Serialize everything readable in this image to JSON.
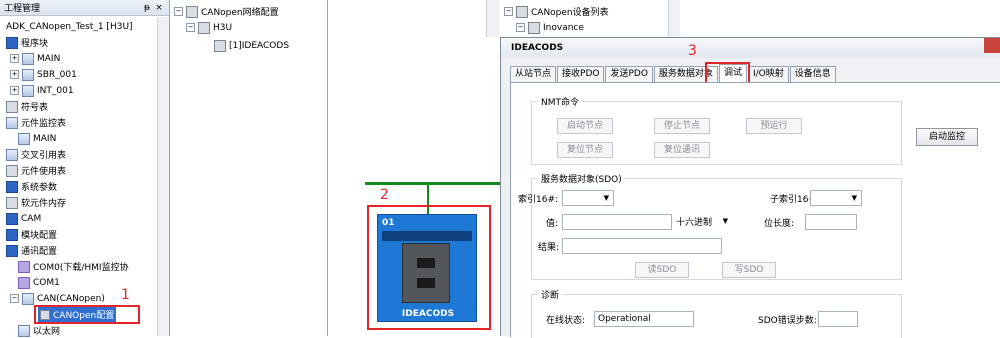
{
  "project_panel": {
    "title": "工程管理",
    "pin": "ᵽ",
    "close": "×",
    "items": [
      {
        "label": "ADK_CANopen_Test_1 [H3U]"
      },
      {
        "label": "程序块"
      },
      {
        "label": "MAIN"
      },
      {
        "label": "SBR_001"
      },
      {
        "label": "INT_001"
      },
      {
        "label": "符号表"
      },
      {
        "label": "元件监控表"
      },
      {
        "label": "MAIN"
      },
      {
        "label": "交叉引用表"
      },
      {
        "label": "元件使用表"
      },
      {
        "label": "系统参数"
      },
      {
        "label": "软元件内存"
      },
      {
        "label": "CAM"
      },
      {
        "label": "模块配置"
      },
      {
        "label": "通讯配置"
      },
      {
        "label": "COM0(下载/HMI监控协"
      },
      {
        "label": "COM1"
      },
      {
        "label": "CAN(CANopen)"
      },
      {
        "label": "CANOpen配置"
      },
      {
        "label": "以太网"
      }
    ]
  },
  "network_tree": {
    "items": [
      {
        "label": "CANopen网络配置"
      },
      {
        "label": "H3U"
      },
      {
        "label": "[1]IDEACODS"
      }
    ]
  },
  "device_list": {
    "items": [
      {
        "label": "CANopen设备列表"
      },
      {
        "label": "Inovance"
      }
    ]
  },
  "canvas": {
    "node_number": "01",
    "node_name": "IDEACODS"
  },
  "annotations": {
    "one": "1",
    "two": "2",
    "three": "3"
  },
  "dialog": {
    "title": "IDEACODS",
    "tabs": [
      {
        "label": "从站节点"
      },
      {
        "label": "接收PDO"
      },
      {
        "label": "发送PDO"
      },
      {
        "label": "服务数据对象"
      },
      {
        "label": "调试"
      },
      {
        "label": "I/O映射"
      },
      {
        "label": "设备信息"
      }
    ],
    "nmt": {
      "label": "NMT命令",
      "start_node": "启动节点",
      "stop_node": "停止节点",
      "pre_operational": "预运行",
      "reset_node": "复位节点",
      "reset_comm": "复位通讯"
    },
    "start_monitor": "启动监控",
    "sdo": {
      "label": "服务数据对象(SDO)",
      "index_label": "索引16#:",
      "subindex_label": "子索引16#:",
      "value_label": "值:",
      "format": "十六进制",
      "bitlen_label": "位长度:",
      "result_label": "结果:",
      "read": "读SDO",
      "write": "写SDO"
    },
    "diag": {
      "label": "诊断",
      "online_status_label": "在线状态:",
      "online_status": "Operational",
      "sdo_error_label": "SDO错误步数:"
    }
  },
  "colors": {
    "accent_red": "#e2242b",
    "node_blue": "#1e78d6",
    "bus_green": "#138a1d"
  }
}
